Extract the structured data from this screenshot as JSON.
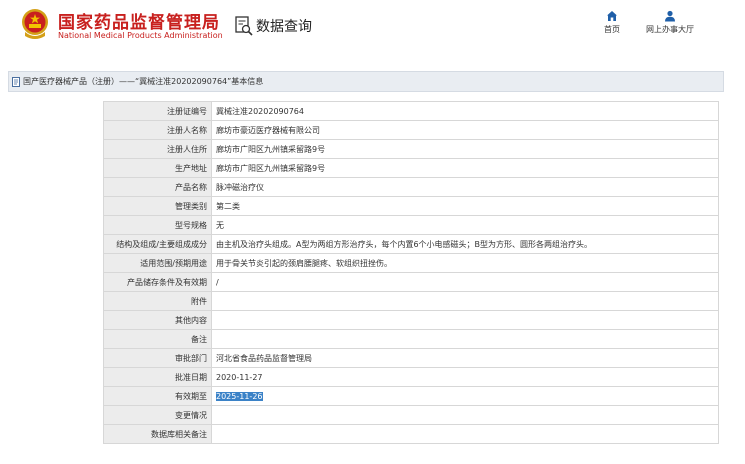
{
  "header": {
    "logo_cn": "国家药品监督管理局",
    "logo_en": "National Medical Products Administration",
    "query_label": "数据查询",
    "nav": [
      {
        "label": "首页",
        "icon": "home-icon"
      },
      {
        "label": "网上办事大厅",
        "icon": "user-icon"
      }
    ]
  },
  "breadcrumb": {
    "text": "国产医疗器械产品（注册）——“冀械注准20202090764”基本信息"
  },
  "record": [
    {
      "label": "注册证编号",
      "value": "冀械注准20202090764"
    },
    {
      "label": "注册人名称",
      "value": "廊坊市豪迈医疗器械有限公司"
    },
    {
      "label": "注册人住所",
      "value": "廊坊市广阳区九州镇采留路9号"
    },
    {
      "label": "生产地址",
      "value": "廊坊市广阳区九州镇采留路9号"
    },
    {
      "label": "产品名称",
      "value": "脉冲磁治疗仪"
    },
    {
      "label": "管理类别",
      "value": "第二类"
    },
    {
      "label": "型号规格",
      "value": "无"
    },
    {
      "label": "结构及组成/主要组成成分",
      "value": "由主机及治疗头组成。A型为两组方形治疗头，每个内置6个小电感磁头；B型为方形、圆形各两组治疗头。"
    },
    {
      "label": "适用范围/预期用途",
      "value": "用于骨关节炎引起的颈肩腰腿疼、软组织扭挫伤。"
    },
    {
      "label": "产品储存条件及有效期",
      "value": "/"
    },
    {
      "label": "附件",
      "value": ""
    },
    {
      "label": "其他内容",
      "value": ""
    },
    {
      "label": "备注",
      "value": ""
    },
    {
      "label": "审批部门",
      "value": "河北省食品药品监督管理局"
    },
    {
      "label": "批准日期",
      "value": "2020-11-27"
    },
    {
      "label": "有效期至",
      "value": "2025-11-26"
    },
    {
      "label": "变更情况",
      "value": ""
    },
    {
      "label": "数据库相关备注",
      "value": ""
    }
  ],
  "colors": {
    "brand_red": "#c8201e",
    "nav_blue": "#1f5fa8",
    "selection": "#3b82c7",
    "label_bg": "#ececec"
  }
}
